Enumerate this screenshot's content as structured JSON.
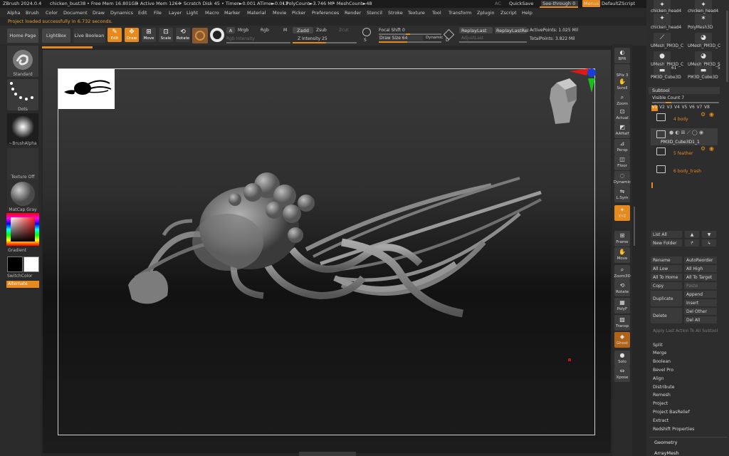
{
  "titlebar": {
    "app": "ZBrush 2024.0.4",
    "file": "chicken_bust38",
    "free_mem": "• Free Mem 16.801GB",
    "active_mem": "• Active Mem 1264",
    "scratch": "• Scratch Disk 45",
    "timer": "• Timer►0.001 ATime►0.013",
    "polycount": "• PolyCount►3.746 MP",
    "meshcount": "• MeshCount►48",
    "ac": "AC",
    "quicksave": "QuickSave",
    "see_through": "See-through  0",
    "menus": "Menus",
    "script": "DefaultZScript"
  },
  "menu": [
    "Alpha",
    "Brush",
    "Color",
    "Document",
    "Draw",
    "Dynamics",
    "Edit",
    "File",
    "Layer",
    "Light",
    "Macro",
    "Marker",
    "Material",
    "Movie",
    "Picker",
    "Preferences",
    "Render",
    "Stencil",
    "Stroke",
    "Texture",
    "Tool",
    "Transform",
    "Zplugin",
    "Zscript",
    "Help"
  ],
  "notice": "Project loaded successfully in 6.732 seconds.",
  "toolbar": {
    "home": "Home Page",
    "lightbox": "LightBox",
    "liveboolean": "Live Boolean",
    "edit": "Edit",
    "draw": "Draw",
    "move": "Move",
    "scale": "Scale",
    "rotate": "Rotate",
    "a": "A",
    "mrgb": "Mrgb",
    "rgb": "Rgb",
    "m": "M",
    "zadd": "Zadd",
    "zsub": "Zsub",
    "zcut": "Zcut",
    "rgb_intensity": "Rgb Intensity",
    "z_intensity": "Z Intensity 25",
    "focal_shift": "Focal Shift 0",
    "draw_size": "Draw Size 64",
    "dynamic": "Dynamic",
    "replay_last": "ReplayLast",
    "replay_last_rel": "ReplayLastRel",
    "adjust_last": "AdjustLast",
    "active_points": "ActivePoints: 1.025 Mil",
    "total_points": "TotalPoints: 3.822 Mil",
    "s": "S",
    "d": "D"
  },
  "leftshelf": {
    "brush": "Standard",
    "stroke": "Dots",
    "alpha": "~BrushAlpha",
    "texture": "Texture Off",
    "material": "MatCap Gray",
    "gradient": "Gradient",
    "switchcolor": "SwitchColor",
    "alternate": "Alternate"
  },
  "rightshelf": [
    {
      "name": "bpr",
      "label": "BPR"
    },
    {
      "name": "spix",
      "label": "SPix 3"
    },
    {
      "name": "scroll",
      "label": "Scroll"
    },
    {
      "name": "zoom",
      "label": "Zoom"
    },
    {
      "name": "actual",
      "label": "Actual"
    },
    {
      "name": "aahalf",
      "label": "AAHalf"
    },
    {
      "name": "persp",
      "label": "Persp"
    },
    {
      "name": "floor",
      "label": "Floor"
    },
    {
      "name": "dynamic",
      "label": "Dynamic"
    },
    {
      "name": "lsym",
      "label": "L.Sym"
    },
    {
      "name": "xyz",
      "label": "XYZ"
    },
    {
      "name": "frame",
      "label": "Frame"
    },
    {
      "name": "move",
      "label": "Move"
    },
    {
      "name": "zoom3d",
      "label": "Zoom3D"
    },
    {
      "name": "rotate",
      "label": "Rotate"
    },
    {
      "name": "polyf",
      "label": "PolyF"
    },
    {
      "name": "transp",
      "label": "Transp"
    },
    {
      "name": "ghost",
      "label": "Ghost"
    },
    {
      "name": "solo",
      "label": "Solo"
    },
    {
      "name": "xpose",
      "label": "Xpose"
    }
  ],
  "palette": {
    "tools": [
      {
        "label": "chicken_head4"
      },
      {
        "label": "chicken_head4"
      },
      {
        "label": "chicken_head4"
      },
      {
        "label": "PolyMesh3D"
      },
      {
        "label": "UMesh_PM3D_C"
      },
      {
        "label": "UMesh_PM3D_C"
      },
      {
        "label": "UMesh_PM3D_C"
      },
      {
        "label": "UMesh_PM3D_S"
      },
      {
        "label": "PM3D_Cube3D"
      },
      {
        "label": "PM3D_Cube3D"
      }
    ],
    "tool_counts": [
      "61",
      "5"
    ],
    "subtool_header": "Subtool",
    "visible_count": "Visible Count 7",
    "versions": [
      "V1",
      "V2",
      "V3",
      "V4",
      "V5",
      "V6",
      "V7",
      "V8"
    ],
    "subtools": [
      {
        "label": "4 body"
      },
      {
        "label": "PM3D_Cube3D1_1"
      },
      {
        "label": "5 feather"
      },
      {
        "label": "6 body_trash"
      }
    ],
    "list_all": "List All",
    "new_folder": "New Folder",
    "rename": "Rename",
    "auto_reorder": "AutoReorder",
    "all_low": "All Low",
    "all_high": "All High",
    "all_to_home": "All To Home",
    "all_to_target": "All To Target",
    "copy": "Copy",
    "paste": "Paste",
    "duplicate": "Duplicate",
    "append": "Append",
    "insert": "Insert",
    "delete": "Delete",
    "del_other": "Del Other",
    "del_all": "Del All",
    "apply_last": "Apply Last Action To All Subtool",
    "sections": [
      "Split",
      "Merge",
      "Boolean",
      "Bevel Pro",
      "Align",
      "Distribute",
      "Remesh",
      "Project",
      "Project BasRelief",
      "Extract",
      "Redshift Properties"
    ],
    "geometry": "Geometry",
    "arraymesh": "ArrayMesh"
  },
  "colors": {
    "accent": "#e68a1e",
    "bg": "#262626",
    "panel": "#2d2d2d"
  }
}
